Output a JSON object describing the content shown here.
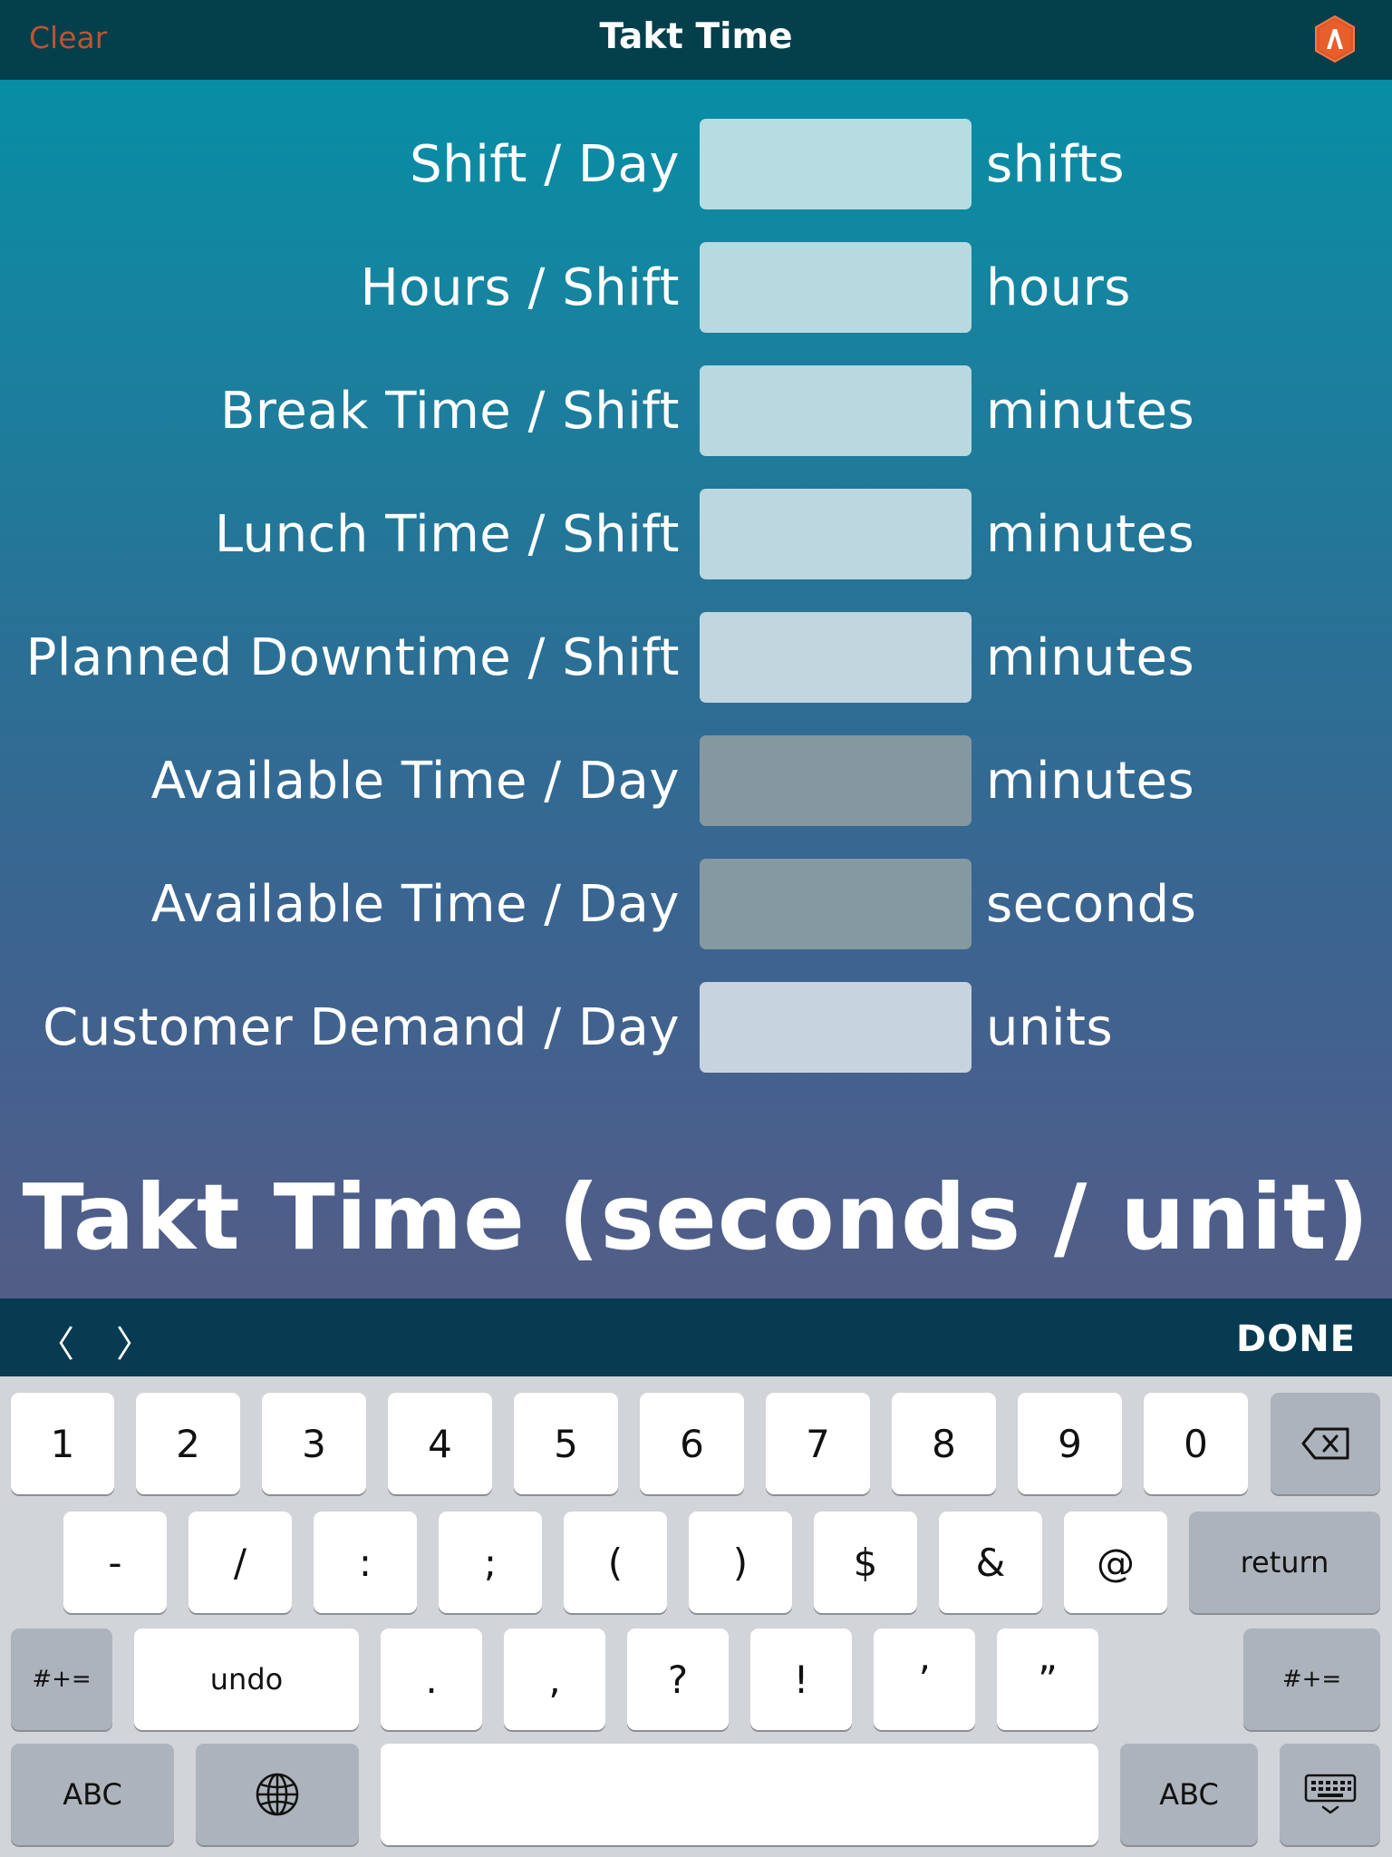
{
  "navbar": {
    "clear_label": "Clear",
    "title": "Takt Time",
    "logo_icon": "app-logo-icon"
  },
  "rows": [
    {
      "label": "Shift / Day",
      "unit": "shifts",
      "value": "",
      "editable": true,
      "field_color": "#b7dde2"
    },
    {
      "label": "Hours / Shift",
      "unit": "hours",
      "value": "",
      "editable": true,
      "field_color": "#b7dae0"
    },
    {
      "label": "Break Time / Shift",
      "unit": "minutes",
      "value": "",
      "editable": true,
      "field_color": "#bad8df"
    },
    {
      "label": "Lunch Time / Shift",
      "unit": "minutes",
      "value": "",
      "editable": true,
      "field_color": "#bcd7df"
    },
    {
      "label": "Planned Downtime / Shift",
      "unit": "minutes",
      "value": "",
      "editable": true,
      "field_color": "#c1d6df"
    },
    {
      "label": "Available Time / Day",
      "unit": "minutes",
      "value": "",
      "editable": false,
      "field_color": "#85989f"
    },
    {
      "label": "Available Time / Day",
      "unit": "seconds",
      "value": "",
      "editable": false,
      "field_color": "#8599a0"
    },
    {
      "label": "Customer Demand / Day",
      "unit": "units",
      "value": "",
      "editable": true,
      "field_color": "#c7d4df"
    }
  ],
  "result": {
    "title": "Takt Time (seconds / unit)"
  },
  "toolbar": {
    "prev_label": "〈",
    "next_label": "〉",
    "done_label": "DONE"
  },
  "keyboard": {
    "row1": [
      "1",
      "2",
      "3",
      "4",
      "5",
      "6",
      "7",
      "8",
      "9",
      "0"
    ],
    "row2": [
      "-",
      "/",
      ":",
      ";",
      "(",
      ")",
      "$",
      "&",
      "@"
    ],
    "return_label": "return",
    "shift_label": "#+=",
    "undo_label": "undo",
    "row3": [
      ".",
      ",",
      "?",
      "!",
      "’",
      "”"
    ],
    "abc_label": "ABC",
    "icons": {
      "delete": "backspace-icon",
      "globe": "globe-icon",
      "dismiss": "keyboard-dismiss-icon"
    }
  }
}
